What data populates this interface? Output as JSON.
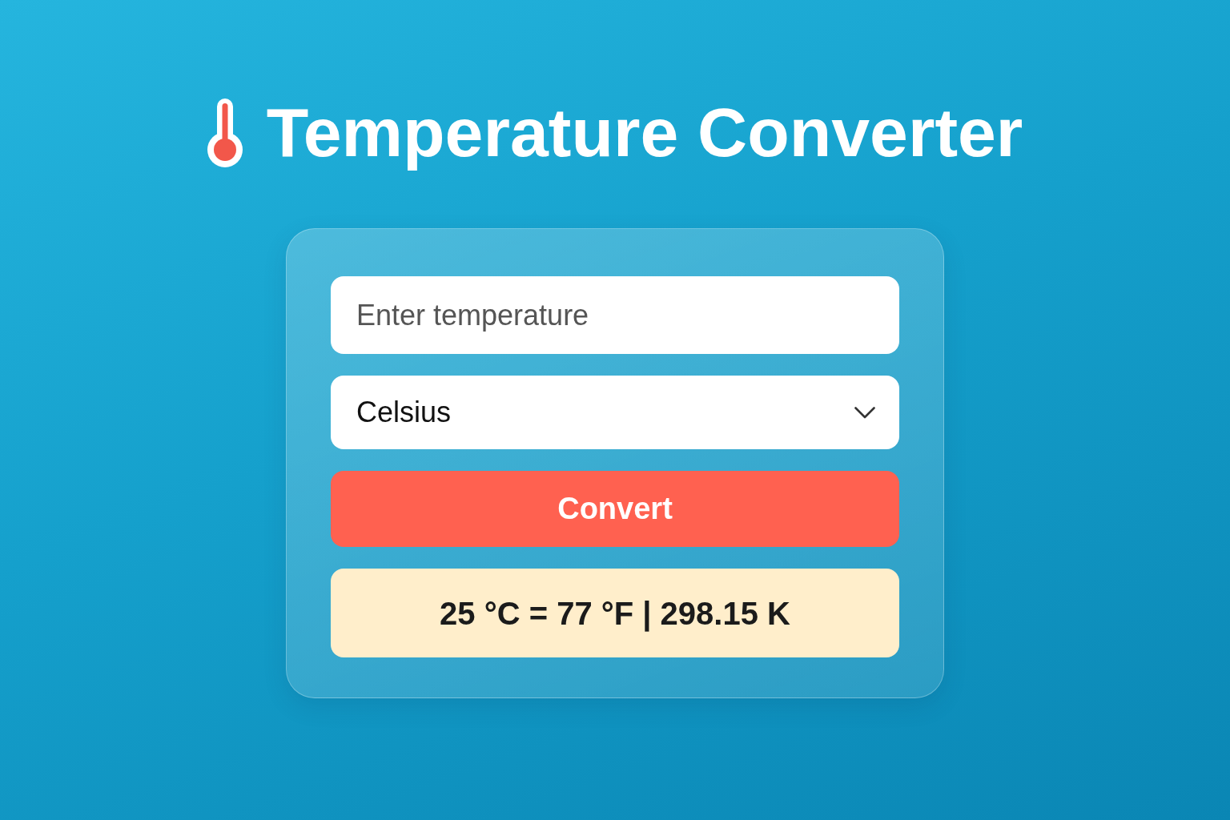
{
  "title": {
    "text": "Temperature Converter"
  },
  "form": {
    "temperature_input": {
      "placeholder": "Enter temperature"
    },
    "unit_select": {
      "value": "Celsius"
    },
    "convert_button": {
      "label": "Convert"
    },
    "result": {
      "text": "25 °C = 77 °F | 298.15 K"
    }
  }
}
